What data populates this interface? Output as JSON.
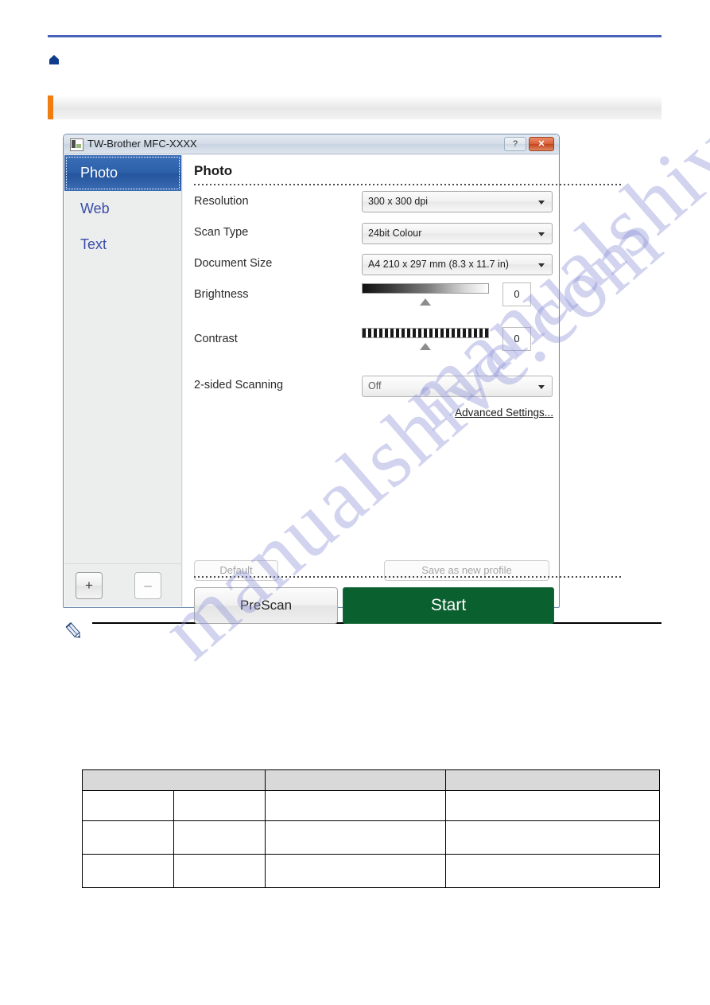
{
  "page": {
    "home_icon": "home-icon",
    "watermark_text": "manualshive.com",
    "accent_color": "#4a62b8",
    "section_accent_color": "#f07d10"
  },
  "dialog": {
    "title": "TW-Brother MFC-XXXX",
    "app_icon": "scanner-icon",
    "help_label": "?",
    "close_label": "✕",
    "sidebar": {
      "modes": [
        {
          "label": "Photo",
          "active": true
        },
        {
          "label": "Web",
          "active": false
        },
        {
          "label": "Text",
          "active": false
        }
      ],
      "add_profile_label": "+",
      "remove_profile_label": "–"
    },
    "pane": {
      "heading": "Photo",
      "fields": [
        {
          "label": "Resolution",
          "value": "300 x 300 dpi"
        },
        {
          "label": "Scan Type",
          "value": "24bit Colour"
        },
        {
          "label": "Document Size",
          "value": "A4 210 x 297 mm (8.3 x 11.7 in)"
        }
      ],
      "brightness": {
        "label": "Brightness",
        "value": "0"
      },
      "contrast": {
        "label": "Contrast",
        "value": "0"
      },
      "two_sided": {
        "label": "2-sided Scanning",
        "value": "Off"
      },
      "advanced_link": "Advanced Settings...",
      "default_button": "Default",
      "save_profile_button": "Save as new profile",
      "prescan_button": "PreScan",
      "start_button": "Start",
      "start_color": "#0b6030"
    }
  },
  "note": {
    "icon": "pencil-icon",
    "text": ""
  },
  "table": {
    "headers": [
      "",
      "",
      "",
      ""
    ],
    "rows": [
      [
        "",
        "",
        "",
        ""
      ],
      [
        "",
        "",
        "",
        ""
      ],
      [
        "",
        "",
        "",
        ""
      ]
    ]
  }
}
